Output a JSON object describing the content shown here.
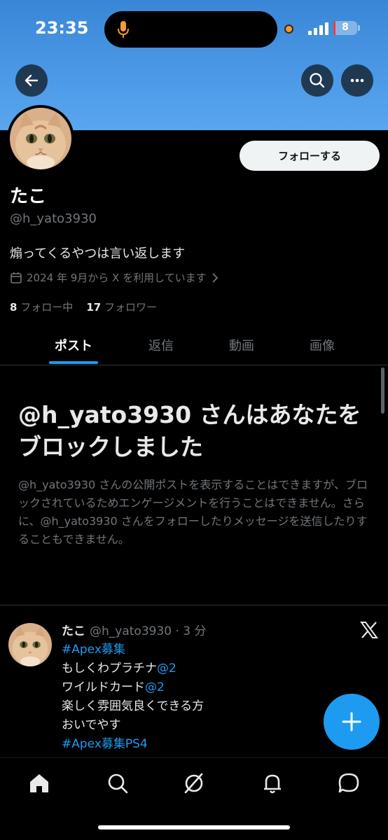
{
  "status_bar": {
    "time": "23:35",
    "battery_level": "8",
    "battery_color": "#ff3b30"
  },
  "header": {
    "back_icon": "arrow-left-icon",
    "search_icon": "search-icon",
    "more_icon": "more-horizontal-icon",
    "banner_color": "#4a98e6"
  },
  "profile": {
    "name": "たこ",
    "handle": "@h_yato3930",
    "bio": "煽ってくるやつは言い返します",
    "joined": "2024 年 9月から X を利用しています",
    "following_count": "8",
    "following_label": "フォロー中",
    "followers_count": "17",
    "followers_label": "フォロワー",
    "follow_button": "フォローする"
  },
  "tabs": [
    {
      "label": "ポスト",
      "active": true
    },
    {
      "label": "返信",
      "active": false
    },
    {
      "label": "動画",
      "active": false
    },
    {
      "label": "画像",
      "active": false
    }
  ],
  "block_notice": {
    "title": "@h_yato3930 さんはあなたをブロックしました",
    "description": "@h_yato3930 さんの公開ポストを表示することはできますが、ブロックされているためエンゲージメントを行うことはできません。さらに、@h_yato3930 さんをフォローしたりメッセージを送信したりすることもできません。"
  },
  "post": {
    "author": "たこ",
    "handle_time": "@h_yato3930 · 3 分",
    "lines": [
      {
        "text": "#Apex募集",
        "link": true
      },
      {
        "text": "もしくわプラチナ",
        "suffix": "@2"
      },
      {
        "text": "ワイルドカード",
        "suffix": "@2"
      },
      {
        "text": "楽しく雰囲気良くできる方"
      },
      {
        "text": "おいでやす"
      },
      {
        "text": "#Apex募集PS4",
        "link": true
      }
    ]
  },
  "fab": {
    "icon": "plus-icon",
    "color": "#1d9bf0"
  },
  "bottom_nav": [
    "home-icon",
    "search-icon",
    "grok-icon",
    "bell-icon",
    "message-icon"
  ],
  "accent_color": "#1d9bf0"
}
